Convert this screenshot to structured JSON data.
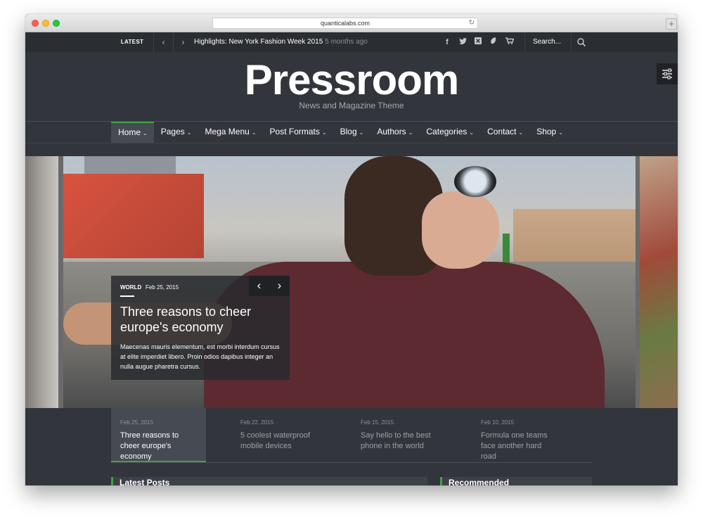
{
  "browser": {
    "url": "quanticalabs.com",
    "new_tab_label": "+"
  },
  "topbar": {
    "latest_label": "LATEST",
    "prev_arrow": "‹",
    "next_arrow": "›",
    "ticker_headline": "Highlights: New York Fashion Week 2015",
    "ticker_time": "5 months ago",
    "social_icons": [
      "facebook-icon",
      "twitter-icon",
      "xing-icon",
      "envato-icon",
      "cart-icon"
    ],
    "search_placeholder": "Search..."
  },
  "header": {
    "logo": "Pressroom",
    "tagline": "News and Magazine Theme"
  },
  "nav": {
    "items": [
      {
        "label": "Home",
        "active": true
      },
      {
        "label": "Pages"
      },
      {
        "label": "Mega Menu"
      },
      {
        "label": "Post Formats"
      },
      {
        "label": "Blog"
      },
      {
        "label": "Authors"
      },
      {
        "label": "Categories"
      },
      {
        "label": "Contact"
      },
      {
        "label": "Shop"
      }
    ],
    "caret": "⌄"
  },
  "slider": {
    "category": "WORLD",
    "date": "Feb 25, 2015",
    "title": "Three reasons to cheer europe's economy",
    "excerpt": "Maecenas mauris elementum, est morbi interdum cursus at elite imperdiet libero. Proin odios dapibus integer an nulla augue pharetra cursus.",
    "prev": "‹",
    "next": "›"
  },
  "thumbnails": [
    {
      "date": "Feb 25, 2015",
      "title": "Three reasons to cheer europe's economy",
      "active": true
    },
    {
      "date": "Feb 22, 2015",
      "title": "5 coolest waterproof mobile devices"
    },
    {
      "date": "Feb 15, 2015",
      "title": "Say hello to the best phone in the world"
    },
    {
      "date": "Feb 10, 2015",
      "title": "Formula one teams face another hard road"
    }
  ],
  "panels": {
    "left_title": "Latest Posts",
    "right_title": "Recommended"
  },
  "colors": {
    "accent": "#43a140",
    "background": "#32353b",
    "topbar": "#2a2d32"
  }
}
